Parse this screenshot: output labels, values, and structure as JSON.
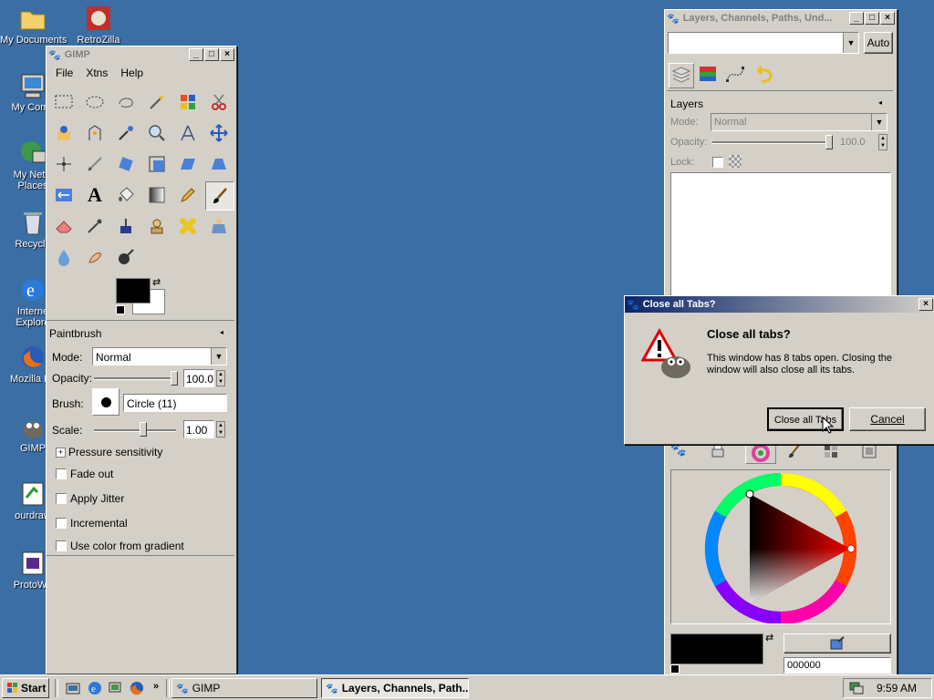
{
  "desktop": {
    "icons": [
      {
        "label": "My Documents"
      },
      {
        "label": "RetroZilla"
      },
      {
        "label": "My Comp"
      },
      {
        "label": "My Netw"
      },
      {
        "label": "Places"
      },
      {
        "label": "Recycle"
      },
      {
        "label": "Interne"
      },
      {
        "label": "Explore"
      },
      {
        "label": "Mozilla Fir"
      },
      {
        "label": "GIMP"
      },
      {
        "label": "ourdraw"
      },
      {
        "label": "ProtoWe"
      }
    ]
  },
  "gimp": {
    "title": "GIMP",
    "menu": [
      "File",
      "Xtns",
      "Help"
    ],
    "tool_options": {
      "header": "Paintbrush",
      "mode_label": "Mode:",
      "mode_value": "Normal",
      "opacity_label": "Opacity:",
      "opacity_value": "100.0",
      "brush_label": "Brush:",
      "brush_value": "Circle (11)",
      "scale_label": "Scale:",
      "scale_value": "1.00",
      "pressure_label": "Pressure sensitivity",
      "fade_label": "Fade out",
      "jitter_label": "Apply Jitter",
      "incremental_label": "Incremental",
      "gradient_label": "Use color from gradient",
      "opacity_fraction": 1.0,
      "scale_fraction": 0.6
    }
  },
  "layers_dock": {
    "title": "Layers, Channels, Paths, Und...",
    "auto_label": "Auto",
    "layers_header": "Layers",
    "mode_label": "Mode:",
    "mode_value": "Normal",
    "opacity_label": "Opacity:",
    "opacity_value": "100.0",
    "lock_label": "Lock:",
    "hex_value": "000000"
  },
  "dialog": {
    "title": "Close all Tabs?",
    "heading": "Close all tabs?",
    "message": "This window has 8 tabs open. Closing the window will also close all its tabs.",
    "confirm_label": "Close all Tabs",
    "cancel_label": "Cancel"
  },
  "taskbar": {
    "start_label": "Start",
    "tasks": [
      {
        "label": "GIMP"
      },
      {
        "label": "Layers, Channels, Path..."
      }
    ],
    "clock": "9:59 AM"
  },
  "colors": {
    "desktop": "#3a6ea5",
    "titlebar_active": "#0a246a",
    "fg_color": "#000000",
    "bg_color": "#ffffff"
  }
}
